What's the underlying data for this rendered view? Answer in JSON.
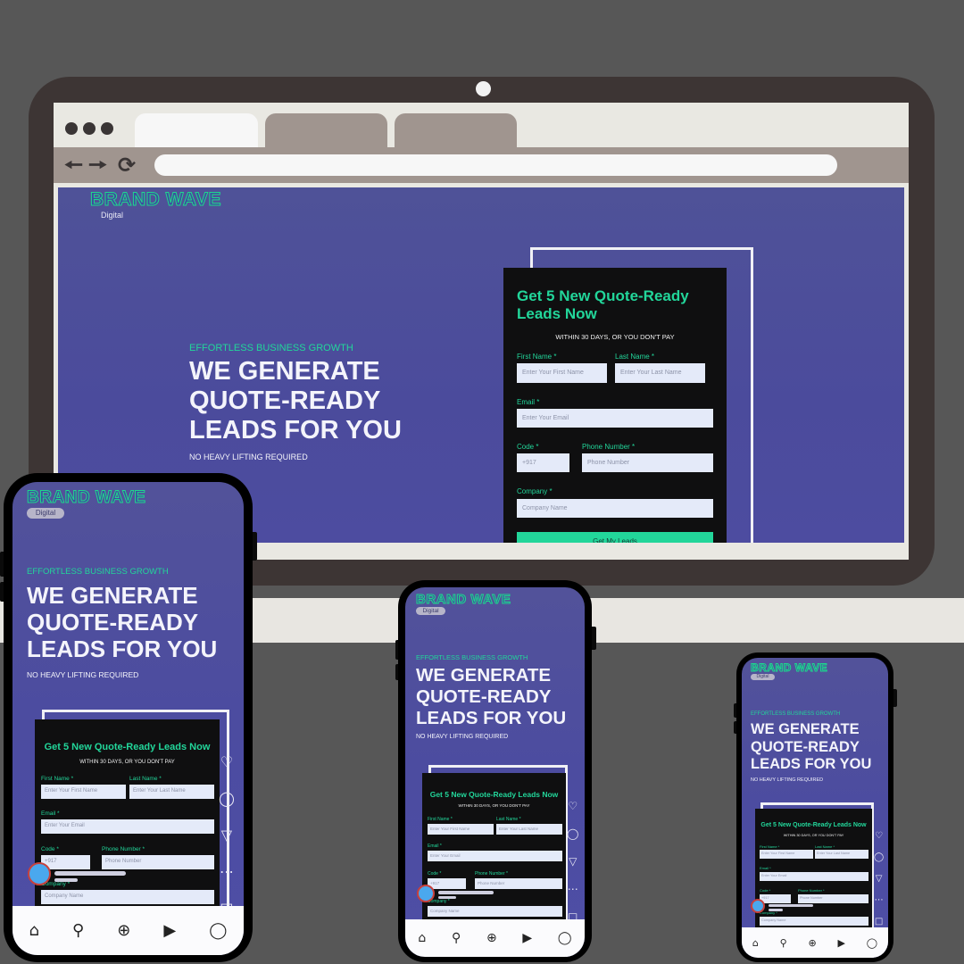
{
  "site": {
    "brand_name": "BRAND WAVE",
    "brand_sub": "Digital",
    "eyebrow": "EFFORTLESS BUSINESS GROWTH",
    "headline": "WE GENERATE\nQUOTE-READY\nLEADS FOR YOU",
    "subline": "NO HEAVY LIFTING REQUIRED"
  },
  "form": {
    "title": "Get 5 New Quote-Ready Leads Now",
    "title_desktop": "Get 5 New Quote-Ready\nLeads Now",
    "subtitle": "WITHIN 30 DAYS, OR YOU DON'T PAY",
    "first_name_label": "First Name *",
    "first_name_placeholder": "Enter Your First Name",
    "last_name_label": "Last Name *",
    "last_name_placeholder": "Enter Your Last Name",
    "email_label": "Email *",
    "email_placeholder": "Enter Your Email",
    "code_label": "Code *",
    "code_value": "+917",
    "phone_label": "Phone Number *",
    "phone_placeholder": "Phone Number",
    "company_label": "Company *",
    "company_placeholder": "Company Name",
    "submit_label": "Get My Leads"
  },
  "icons": {
    "browser_back": "arrow-left-icon",
    "browser_forward": "arrow-right-icon",
    "browser_reload": "reload-icon",
    "side": [
      "heart-icon",
      "comment-icon",
      "send-icon",
      "more-icon",
      "bookmark-icon"
    ],
    "bottom_nav": [
      "home-icon",
      "search-icon",
      "add-icon",
      "reels-icon",
      "profile-icon"
    ]
  },
  "colors": {
    "background": "#575757",
    "page_gradient": "#4f5298",
    "accent_green": "#22d69a",
    "form_card": "#0f0f10",
    "input_bg": "#e4eaf9"
  }
}
